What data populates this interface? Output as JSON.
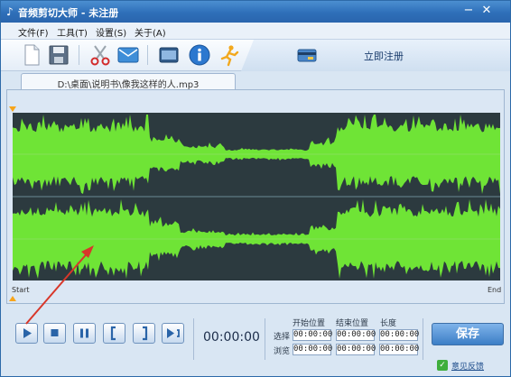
{
  "window": {
    "title": "音频剪切大师 - 未注册",
    "icon": "music-note-icon"
  },
  "menu": [
    "文件(F)",
    "工具(T)",
    "设置(S)",
    "关于(A)"
  ],
  "toolbar": {
    "tools": [
      "new-file-icon",
      "save-icon",
      "cut-icon",
      "mail-icon",
      "screen-icon",
      "info-icon",
      "runner-icon"
    ],
    "register_label": "立即注册"
  },
  "file_tab": {
    "path": "D:\\桌面\\说明书\\像我这样的人.mp3"
  },
  "waveform": {
    "start_label": "Start",
    "end_label": "End",
    "colors": {
      "background": "#2c3a3f",
      "wave": "#6fe436",
      "selection_marker": "#f7a51b"
    }
  },
  "transport": {
    "time": "00:00:00",
    "buttons": [
      "play-icon",
      "stop-icon",
      "pause-icon",
      "mark-start-icon",
      "mark-end-icon",
      "play-selection-icon"
    ]
  },
  "positions": {
    "header_start": "开始位置",
    "header_end": "结束位置",
    "header_length": "长度",
    "select_label": "选择",
    "preview_label": "浏览",
    "select": {
      "start": "00:00:00",
      "end": "00:00:00",
      "length": "00:00:00"
    },
    "preview": {
      "start": "00:00:00",
      "end": "00:00:00",
      "length": "00:00:00"
    }
  },
  "actions": {
    "save_label": "保存",
    "feedback_label": "意见反馈"
  },
  "annotation": {
    "arrow_color": "#d8372a"
  }
}
